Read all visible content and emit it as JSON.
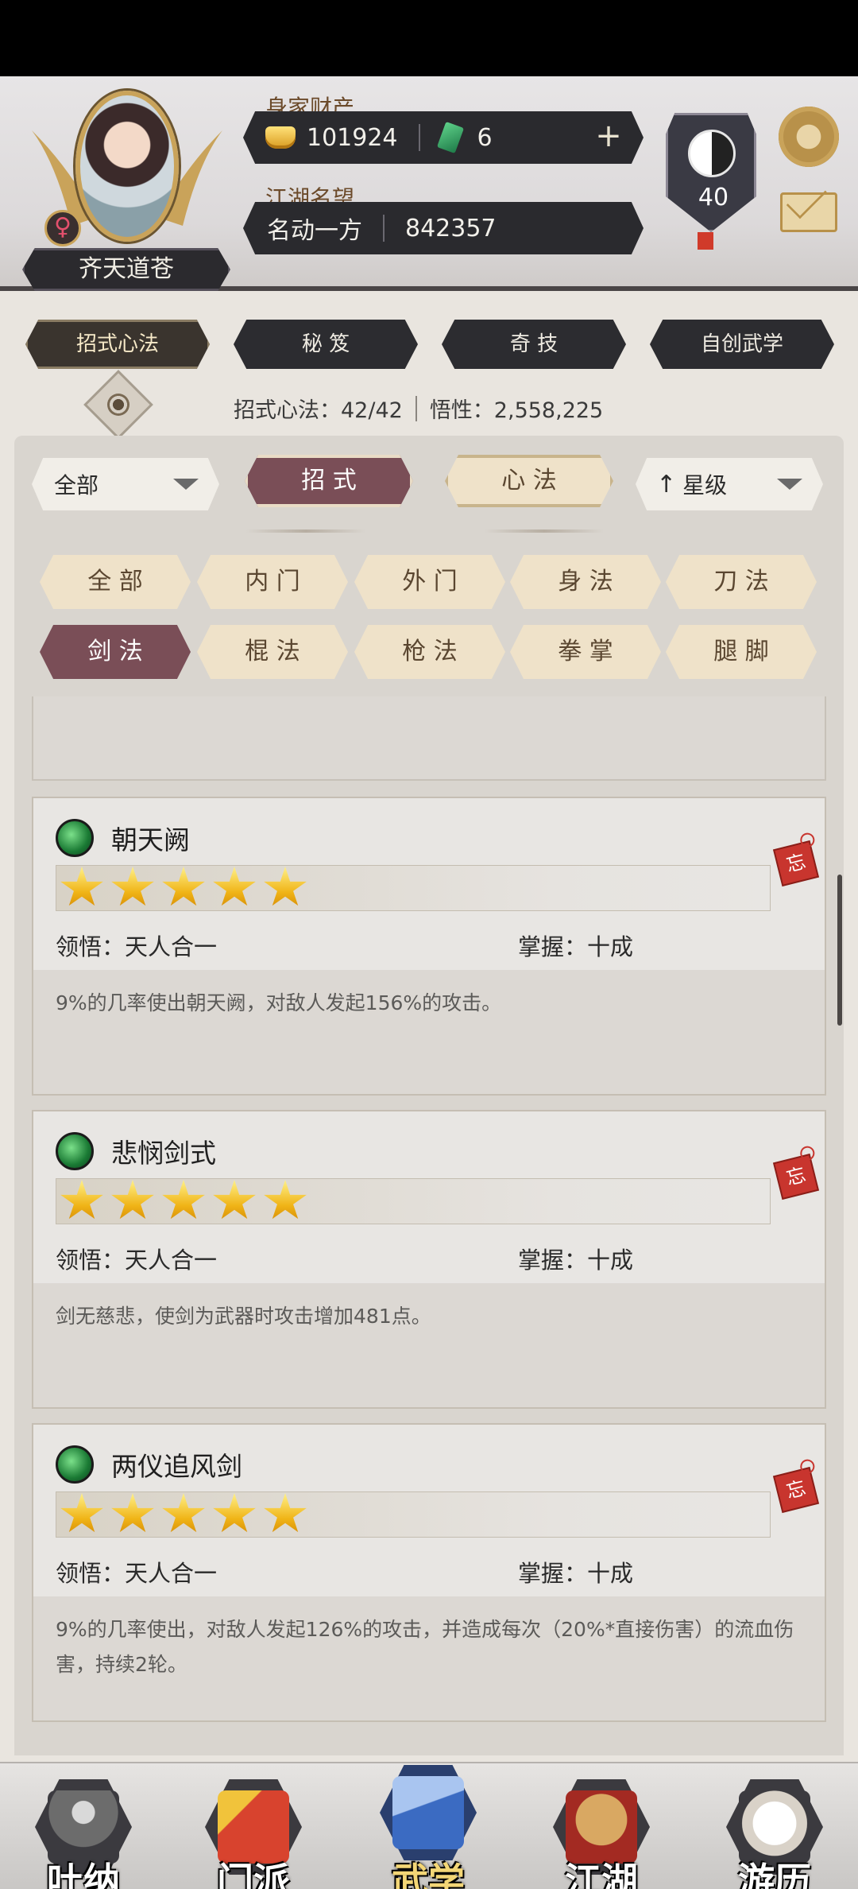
{
  "header": {
    "player_name": "齐天道苍",
    "gender_symbol": "♀",
    "wealth_label": "身家财产",
    "gold": "101924",
    "jade": "6",
    "plus": "+",
    "reputation_label": "江湖名望",
    "reputation_title": "名动一方",
    "reputation_value": "842357",
    "level": "40"
  },
  "main_tabs": [
    {
      "label": "招式心法",
      "active": true
    },
    {
      "label": "秘 笈",
      "active": false
    },
    {
      "label": "奇 技",
      "active": false
    },
    {
      "label": "自创武学",
      "active": false
    }
  ],
  "stats": {
    "skills": "招式心法：42/42",
    "insight": "悟性：2,558,225"
  },
  "filters": {
    "scope": "全部",
    "type_tabs": [
      {
        "label": "招 式",
        "active": true
      },
      {
        "label": "心 法",
        "active": false
      }
    ],
    "sort": "星级",
    "categories": [
      {
        "label": "全 部",
        "active": false
      },
      {
        "label": "内 门",
        "active": false
      },
      {
        "label": "外 门",
        "active": false
      },
      {
        "label": "身 法",
        "active": false
      },
      {
        "label": "刀 法",
        "active": false
      },
      {
        "label": "剑 法",
        "active": true
      },
      {
        "label": "棍 法",
        "active": false
      },
      {
        "label": "枪 法",
        "active": false
      },
      {
        "label": "拳 掌",
        "active": false
      },
      {
        "label": "腿 脚",
        "active": false
      }
    ]
  },
  "skills": [
    {
      "name": "朝天阙",
      "stars": 5,
      "comprehension": "领悟：天人合一",
      "mastery": "掌握：十成",
      "description": "9%的几率使出朝天阙，对敌人发起156%的攻击。",
      "forget_tag": "忘"
    },
    {
      "name": "悲悯剑式",
      "stars": 5,
      "comprehension": "领悟：天人合一",
      "mastery": "掌握：十成",
      "description": "剑无慈悲，使剑为武器时攻击增加481点。",
      "forget_tag": "忘"
    },
    {
      "name": "两仪追风剑",
      "stars": 5,
      "comprehension": "领悟：天人合一",
      "mastery": "掌握：十成",
      "description": "9%的几率使出，对敌人发起126%的攻击，并造成每次（20%*直接伤害）的流血伤害，持续2轮。",
      "forget_tag": "忘"
    }
  ],
  "bottom_nav": [
    {
      "label": "吐纳",
      "active": false,
      "color": "#6c6c6c"
    },
    {
      "label": "门派",
      "active": false,
      "color": "#d8432e"
    },
    {
      "label": "武学",
      "active": true,
      "color": "#3b6bc2"
    },
    {
      "label": "江湖",
      "active": false,
      "color": "#b8803e"
    },
    {
      "label": "游历",
      "active": false,
      "color": "#e8e2da"
    }
  ]
}
